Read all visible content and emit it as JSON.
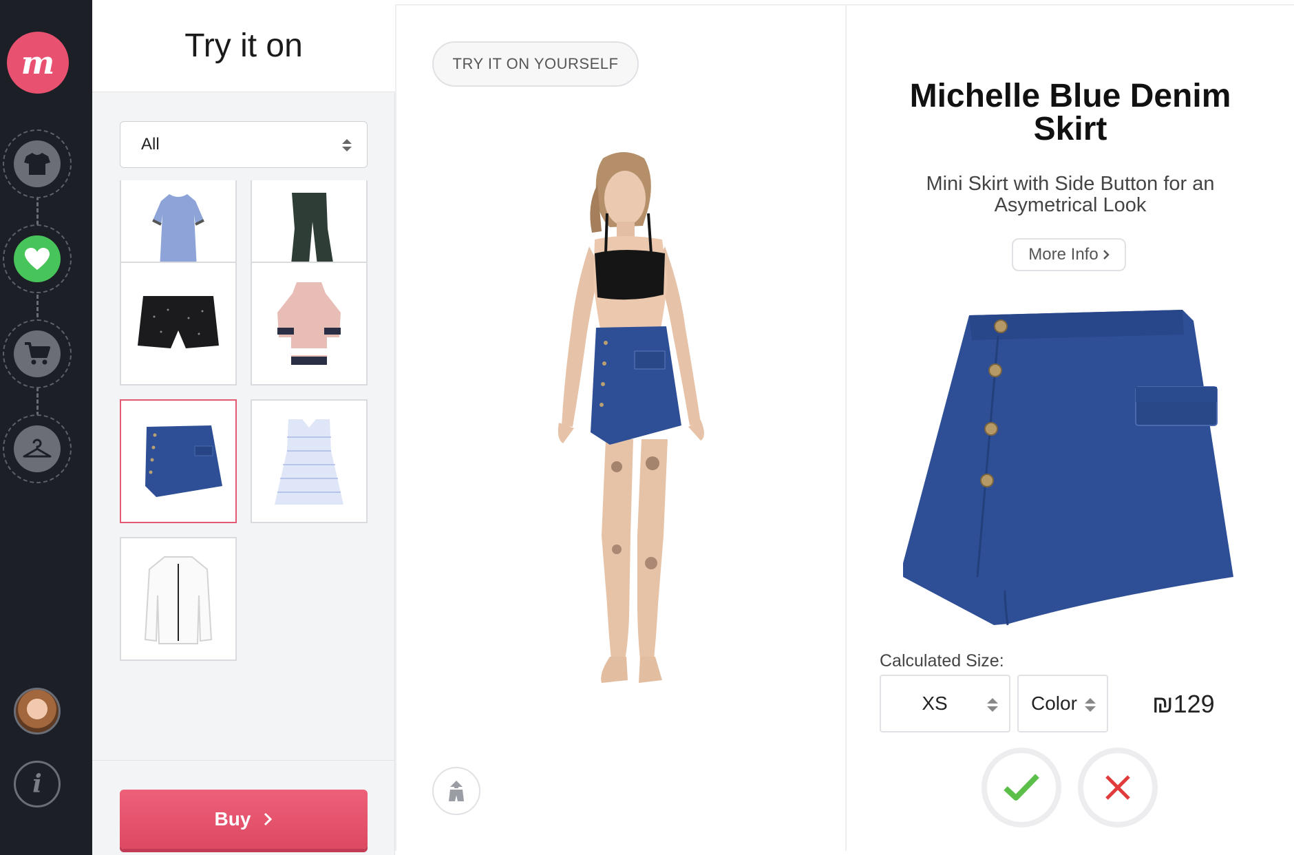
{
  "sidebar": {
    "logo_text": "m",
    "nav": [
      {
        "name": "tshirt-icon"
      },
      {
        "name": "heart-icon",
        "active": true
      },
      {
        "name": "cart-icon"
      },
      {
        "name": "hanger-icon"
      }
    ],
    "info_text": "i"
  },
  "catalog": {
    "title": "Try it on",
    "filter": {
      "selected": "All"
    },
    "items": [
      {
        "name": "blue-dress"
      },
      {
        "name": "green-trousers"
      },
      {
        "name": "black-shorts"
      },
      {
        "name": "pink-top"
      },
      {
        "name": "denim-skirt",
        "selected": true
      },
      {
        "name": "striped-top"
      },
      {
        "name": "white-shirt"
      }
    ],
    "buy_label": "Buy"
  },
  "stage": {
    "try_label": "TRY IT ON YOURSELF"
  },
  "product": {
    "title": "Michelle Blue Denim Skirt",
    "subtitle": "Mini Skirt with Side Button for an Asymetrical Look",
    "more_info_label": "More Info",
    "size_label": "Calculated Size:",
    "size_value": "XS",
    "color_value": "Color",
    "price": "₪129"
  },
  "colors": {
    "brand": "#e8516f",
    "active": "#47c45a",
    "accept": "#5cbf4a",
    "reject": "#e23b3b",
    "denim": "#2e4f96"
  }
}
